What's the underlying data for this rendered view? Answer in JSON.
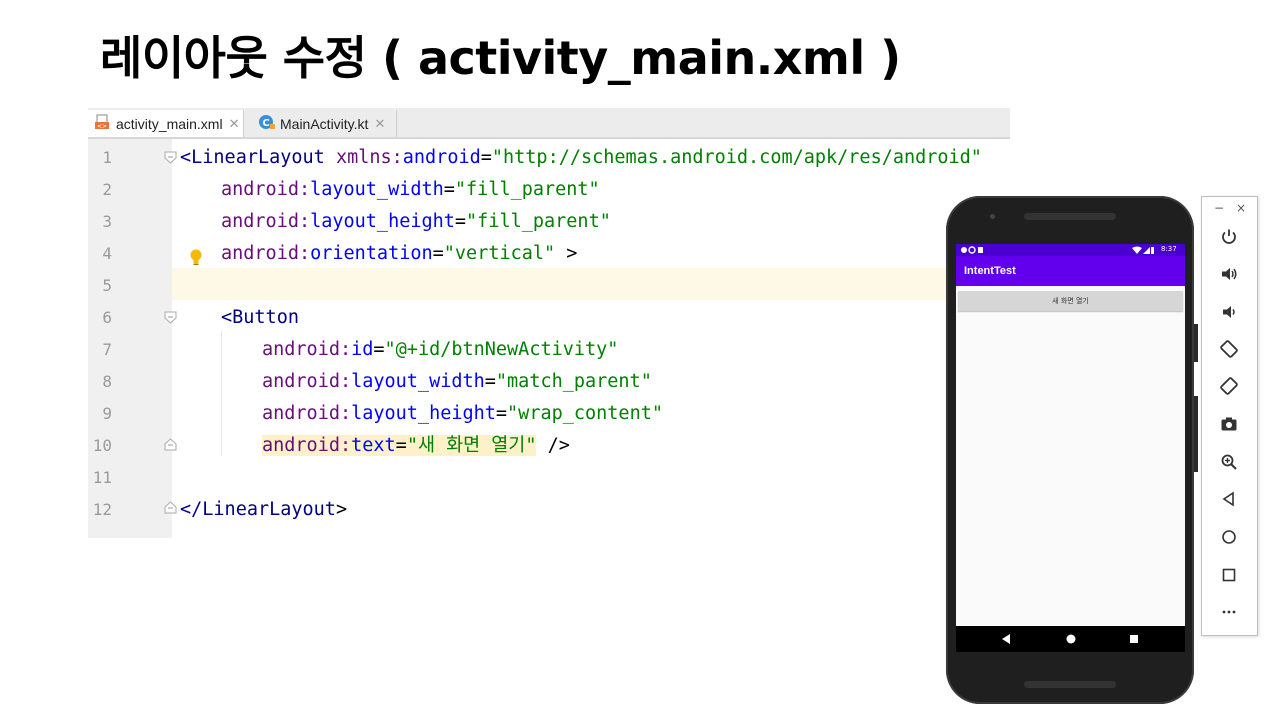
{
  "slide": {
    "title": "레이아웃 수정 ( activity_main.xml )"
  },
  "editor": {
    "tabs": [
      {
        "label": "activity_main.xml",
        "icon": "xml-file-icon",
        "active": true
      },
      {
        "label": "MainActivity.kt",
        "icon": "kotlin-file-icon",
        "active": false
      }
    ],
    "current_line": 5,
    "lines": [
      {
        "n": "1",
        "tokens": [
          [
            "tag",
            "<LinearLayout "
          ],
          [
            "ns",
            "xmlns:"
          ],
          [
            "attr",
            "android"
          ],
          [
            "punct",
            "="
          ],
          [
            "val",
            "\"http://schemas.android.com/apk/res/android\""
          ]
        ]
      },
      {
        "n": "2",
        "indent": 1,
        "tokens": [
          [
            "ns",
            "android:"
          ],
          [
            "attr",
            "layout_width"
          ],
          [
            "punct",
            "="
          ],
          [
            "val",
            "\"fill_parent\""
          ]
        ]
      },
      {
        "n": "3",
        "indent": 1,
        "tokens": [
          [
            "ns",
            "android:"
          ],
          [
            "attr",
            "layout_height"
          ],
          [
            "punct",
            "="
          ],
          [
            "val",
            "\"fill_parent\""
          ]
        ]
      },
      {
        "n": "4",
        "indent": 1,
        "tokens": [
          [
            "ns",
            "android:"
          ],
          [
            "attr",
            "orientation"
          ],
          [
            "punct",
            "="
          ],
          [
            "val",
            "\"vertical\""
          ],
          [
            "punct",
            " >"
          ]
        ]
      },
      {
        "n": "5",
        "tokens": []
      },
      {
        "n": "6",
        "indent": 1,
        "tokens": [
          [
            "tag",
            "<Button"
          ]
        ]
      },
      {
        "n": "7",
        "indent": 2,
        "tokens": [
          [
            "ns",
            "android:"
          ],
          [
            "attr",
            "id"
          ],
          [
            "punct",
            "="
          ],
          [
            "val",
            "\"@+id/btnNewActivity\""
          ]
        ]
      },
      {
        "n": "8",
        "indent": 2,
        "tokens": [
          [
            "ns",
            "android:"
          ],
          [
            "attr",
            "layout_width"
          ],
          [
            "punct",
            "="
          ],
          [
            "val",
            "\"match_parent\""
          ]
        ]
      },
      {
        "n": "9",
        "indent": 2,
        "tokens": [
          [
            "ns",
            "android:"
          ],
          [
            "attr",
            "layout_height"
          ],
          [
            "punct",
            "="
          ],
          [
            "val",
            "\"wrap_content\""
          ]
        ]
      },
      {
        "n": "10",
        "indent": 2,
        "highlight": true,
        "tokens": [
          [
            "ns",
            "android:"
          ],
          [
            "attr",
            "text"
          ],
          [
            "punct",
            "="
          ],
          [
            "val",
            "\"새 화면 열기\""
          ],
          [
            "punct",
            " />"
          ]
        ]
      },
      {
        "n": "11",
        "tokens": []
      },
      {
        "n": "12",
        "tokens": [
          [
            "tag",
            "</LinearLayout"
          ],
          [
            "punct",
            ">"
          ]
        ]
      }
    ]
  },
  "phone": {
    "status_time": "8:37",
    "app_title": "IntentTest",
    "button_label": "새 화면 열기",
    "colors": {
      "status": "#4a00d0",
      "appbar": "#6200ee"
    },
    "nav": [
      "back-icon",
      "home-icon",
      "recents-icon"
    ]
  },
  "emulator_toolbar": {
    "window_controls": [
      "−",
      "×"
    ],
    "buttons": [
      "power-icon",
      "volume-up-icon",
      "volume-down-icon",
      "rotate-left-icon",
      "rotate-right-icon",
      "camera-icon",
      "zoom-icon",
      "back-icon",
      "home-icon",
      "overview-icon",
      "more-icon"
    ]
  }
}
